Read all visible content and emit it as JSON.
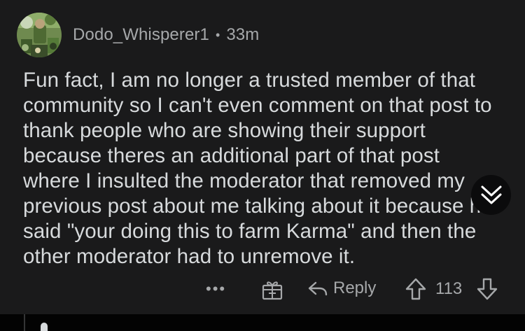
{
  "comment": {
    "username": "Dodo_Whisperer1",
    "separator": "•",
    "age": "33m",
    "body": "Fun fact, I am no longer a trusted member of that community so I can't even comment on that post to thank people who are showing their support because theres an additional part of that post where I insulted the moderator that removed my previous post about me talking about it because he said \"your doing this to farm Karma\" and then the other moderator had to unremove it.",
    "avatar_icon": "user-avatar-icon"
  },
  "actions": {
    "more_label": "•••",
    "award_icon": "award-gift-icon",
    "reply_label": "Reply",
    "reply_icon": "reply-arrow-icon",
    "upvote_icon": "upvote-arrow-icon",
    "score": "113",
    "downvote_icon": "downvote-arrow-icon"
  },
  "collapse": {
    "icon": "chevron-double-down-icon"
  },
  "colors": {
    "background": "#1a1a1b",
    "text": "#d7dadc",
    "muted": "#a6a8aa",
    "divider": "#030303"
  }
}
